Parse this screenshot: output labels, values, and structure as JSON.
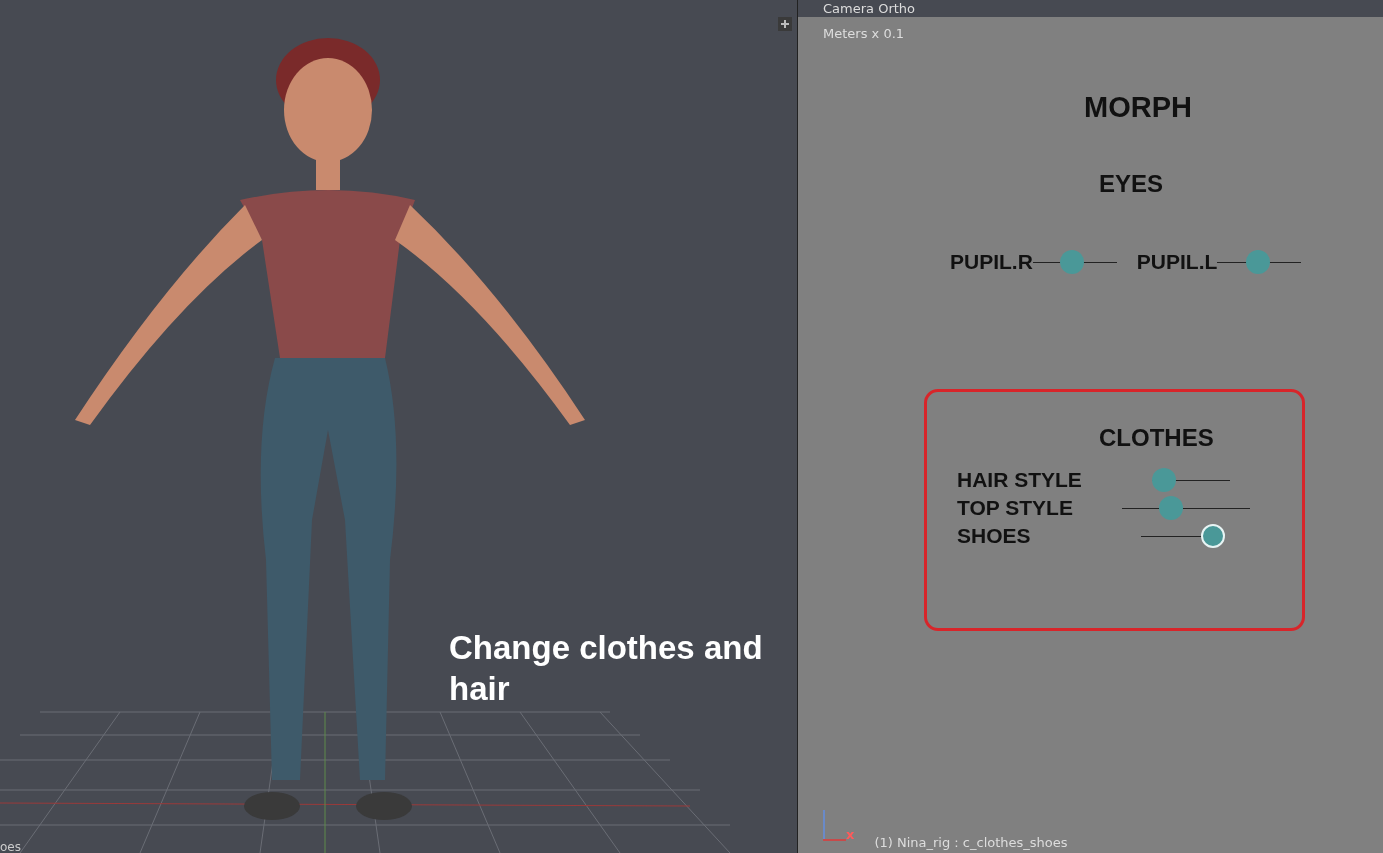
{
  "viewport": {
    "caption": "Change clothes and hair",
    "corner_text": "oes"
  },
  "panel": {
    "header": "Camera Ortho",
    "units": "Meters x 0.1",
    "title": "MORPH",
    "eyes": {
      "heading": "EYES",
      "sliders": [
        {
          "label": "PUPIL.R",
          "level": 0.45,
          "selected": false
        },
        {
          "label": "PUPIL.L",
          "level": 0.47,
          "selected": false
        }
      ]
    },
    "clothes": {
      "heading": "CLOTHES",
      "sliders": [
        {
          "label": "HAIR STYLE",
          "level": 0.0,
          "selected": false
        },
        {
          "label": "TOP STYLE",
          "level": 0.36,
          "selected": false
        },
        {
          "label": "SHOES",
          "level": 1.0,
          "selected": true
        }
      ]
    },
    "axis_label": "x",
    "status": "(1) Nina_rig : c_clothes_shoes"
  }
}
